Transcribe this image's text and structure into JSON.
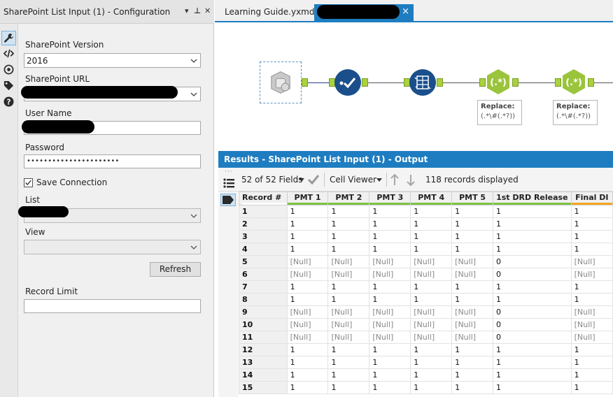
{
  "config": {
    "title": "SharePoint List Input (1) - Configuration",
    "title_controls": [
      "▾",
      "⊥",
      "✕"
    ],
    "version_label": "SharePoint Version",
    "version_value": "2016",
    "url_label": "SharePoint URL",
    "username_label": "User Name",
    "password_label": "Password",
    "password_value": "••••••••••••••••••••••",
    "save_connection_label": "Save Connection",
    "list_label": "List",
    "view_label": "View",
    "refresh_label": "Refresh",
    "record_limit_label": "Record Limit"
  },
  "tabs": {
    "learning_guide": "Learning Guide.yxmd",
    "close": "×"
  },
  "canvas": {
    "annotation_1": {
      "title": "Replace:",
      "body": "(.*\\#(.*?))"
    },
    "annotation_2": {
      "title": "Replace:",
      "body": "(.*\\#(.*?))"
    },
    "regex_symbol": "(.*)"
  },
  "results": {
    "header": "Results - SharePoint List Input (1) - Output",
    "fields_selector": "52 of 52 Fields",
    "cell_viewer": "Cell Viewer",
    "records_displayed": "118 records displayed",
    "columns": [
      "Record #",
      "PMT 1",
      "PMT 2",
      "PMT 3",
      "PMT 4",
      "PMT 5",
      "1st DRD Release",
      "Final DI"
    ],
    "rows": [
      [
        "1",
        "1",
        "1",
        "1",
        "1",
        "1",
        "1",
        "1"
      ],
      [
        "2",
        "1",
        "1",
        "1",
        "1",
        "1",
        "1",
        "1"
      ],
      [
        "3",
        "1",
        "1",
        "1",
        "1",
        "1",
        "1",
        "1"
      ],
      [
        "4",
        "1",
        "1",
        "1",
        "1",
        "1",
        "1",
        "1"
      ],
      [
        "5",
        "[Null]",
        "[Null]",
        "[Null]",
        "[Null]",
        "[Null]",
        "0",
        "[Null]"
      ],
      [
        "6",
        "[Null]",
        "[Null]",
        "[Null]",
        "[Null]",
        "[Null]",
        "0",
        "[Null]"
      ],
      [
        "7",
        "1",
        "1",
        "1",
        "1",
        "1",
        "1",
        "1"
      ],
      [
        "8",
        "1",
        "1",
        "1",
        "1",
        "1",
        "1",
        "1"
      ],
      [
        "9",
        "[Null]",
        "[Null]",
        "[Null]",
        "[Null]",
        "[Null]",
        "0",
        "[Null]"
      ],
      [
        "10",
        "[Null]",
        "[Null]",
        "[Null]",
        "[Null]",
        "[Null]",
        "0",
        "[Null]"
      ],
      [
        "11",
        "[Null]",
        "[Null]",
        "[Null]",
        "[Null]",
        "[Null]",
        "0",
        "[Null]"
      ],
      [
        "12",
        "1",
        "1",
        "1",
        "1",
        "1",
        "1",
        "1"
      ],
      [
        "13",
        "1",
        "1",
        "1",
        "1",
        "1",
        "1",
        "1"
      ],
      [
        "14",
        "1",
        "1",
        "1",
        "1",
        "1",
        "1",
        "1"
      ],
      [
        "15",
        "1",
        "1",
        "1",
        "1",
        "1",
        "1",
        "1"
      ]
    ],
    "header_underline_colors": [
      "#ffffff",
      "#7cc242",
      "#7cc242",
      "#7cc242",
      "#7cc242",
      "#7cc242",
      "#7cc242",
      "#f5a623"
    ]
  },
  "colors": {
    "accent": "#1e7dc0",
    "tool_blue": "#1a4f8b",
    "tool_green": "#9ac43c",
    "anchor_green": "#a9d23c"
  },
  "icons": {
    "config_sidebar": [
      "wrench-icon",
      "code-icon",
      "globe-icon",
      "tag-icon",
      "help-icon"
    ],
    "results_side": [
      "list-icon",
      "tag-icon"
    ],
    "toolbar": [
      "checkmark-icon",
      "arrow-up-icon",
      "arrow-down-icon"
    ]
  }
}
